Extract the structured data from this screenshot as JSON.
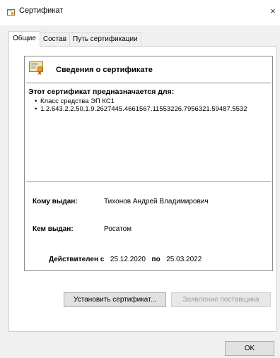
{
  "window": {
    "title": "Сертификат",
    "close_glyph": "×"
  },
  "tabs": [
    {
      "label": "Общие",
      "active": true
    },
    {
      "label": "Состав",
      "active": false
    },
    {
      "label": "Путь сертификации",
      "active": false
    }
  ],
  "info": {
    "header": "Сведения о сертификате",
    "purpose_title": "Этот сертификат предназначается для:",
    "purposes": [
      "Класс средства ЭП КС1",
      "1.2.643.2.2.50.1.9.2627445.4661567.11553226.7956321.59487.5532"
    ],
    "issued_to_label": "Кому выдан:",
    "issued_to_value": "Тихонов Андрей Владимирович",
    "issued_by_label": "Кем выдан:",
    "issued_by_value": "Росатом",
    "valid_from_label": "Действителен с",
    "valid_from": "25.12.2020",
    "valid_to_label": "по",
    "valid_to": "25.03.2022"
  },
  "buttons": {
    "install": "Установить сертификат...",
    "provider": "Заявление поставщика",
    "ok": "OK"
  },
  "icons": {
    "title_icon": "certificate-icon",
    "info_icon": "certificate-ribbon-icon",
    "close_icon": "close-icon"
  }
}
